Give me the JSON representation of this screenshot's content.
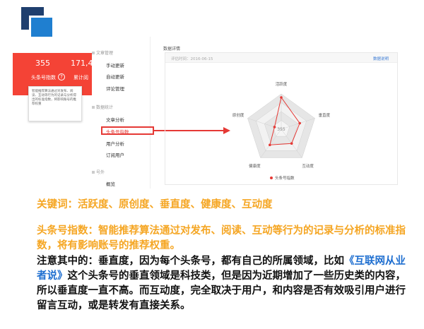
{
  "card": {
    "value1": "355",
    "value2": "171,4",
    "label1": "头条号指数",
    "label2": "累计阅",
    "help_icon": "?",
    "tooltip": "智能推荐算法通过对发布、阅读、互动等行为的记录与分析得出的标准指数，将影响账号的推荐权重"
  },
  "sidebar": {
    "groups": [
      "文章管理",
      "数据统计",
      "号外"
    ],
    "items_article": [
      "手动更新",
      "自动更新",
      "评论管理"
    ],
    "items_stats": [
      "文章分析",
      "头条号指数",
      "用户分析",
      "订阅用户"
    ],
    "items_extra": [
      "概览"
    ]
  },
  "panel": {
    "title": "数据详情",
    "time": "评估时间：2016-06-15",
    "link": "数据说明"
  },
  "chart_data": {
    "type": "radar",
    "axes": [
      "活跃度",
      "垂直度",
      "互动度",
      "健康度",
      "原创度"
    ],
    "series": [
      {
        "name": "头条号指数",
        "values": [
          0.9,
          0.55,
          0.5,
          0.55,
          0.2
        ]
      }
    ],
    "center_label": "355",
    "color": "#e53935"
  },
  "text": {
    "keywords": "关键词：活跃度、原创度、垂直度、健康度、互动度",
    "definition": "头条号指数：智能推荐算法通过对发布、阅读、互动等行为的记录与分析的标准指数，将有影响账号的推荐权重。",
    "note_part1": "注意其中的：垂直度，因为每个头条号，都有自己的所属领域，比如",
    "note_book": "《互联网从业者说》",
    "note_part2": "这个头条号的垂直领域是科技类，但是因为近期增加了一些历史类的内容，所以垂直度一直不高。而互动度，完全取决于用户，和内容是否有效吸引用户进行留言互动，或是转发有直接关系。"
  }
}
